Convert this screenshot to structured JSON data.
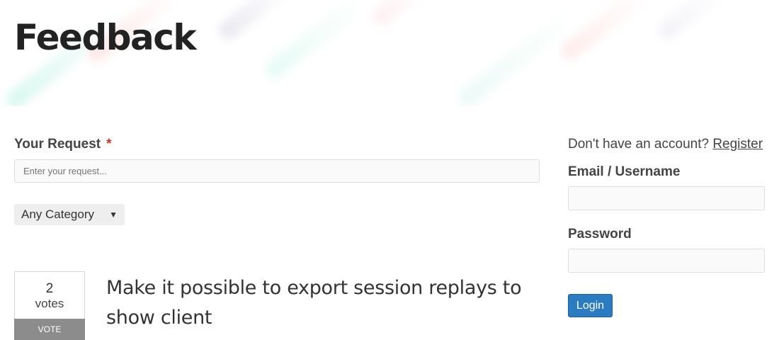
{
  "page": {
    "title": "Feedback"
  },
  "request_form": {
    "label": "Your Request",
    "required_marker": "*",
    "input_placeholder": "Enter your request...",
    "input_value": "",
    "category_selected": "Any Category"
  },
  "ideas": [
    {
      "votes": "2",
      "votes_label": "votes",
      "vote_button": "VOTE",
      "title": "Make it possible to export session replays to show client"
    }
  ],
  "login": {
    "account_prompt": "Don't have an account?",
    "register_link": "Register",
    "email_label": "Email / Username",
    "email_value": "",
    "password_label": "Password",
    "password_value": "",
    "login_button": "Login"
  },
  "icons": {
    "category_caret": "chevron-down-icon"
  },
  "colors": {
    "primary_button": "#2a7bc0",
    "required_marker": "#c0392b",
    "vote_button": "#8c8c8c"
  }
}
